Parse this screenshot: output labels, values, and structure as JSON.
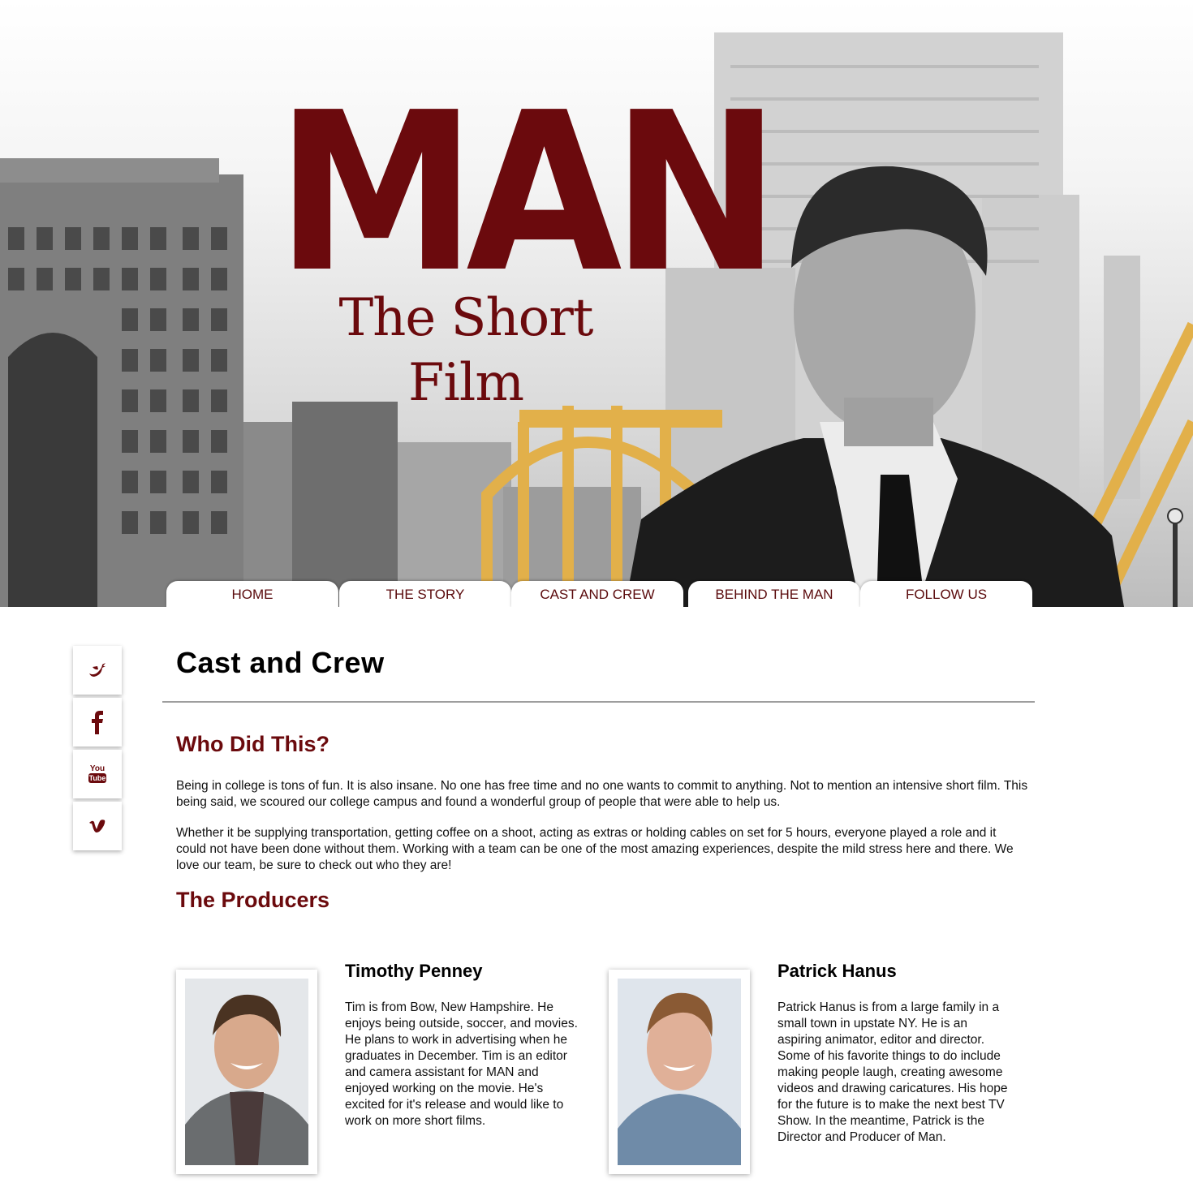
{
  "hero": {
    "logo_title": "MAN",
    "logo_subtitle": "The Short Film"
  },
  "nav": {
    "items": [
      {
        "label": "HOME"
      },
      {
        "label": "THE STORY"
      },
      {
        "label": "CAST AND CREW"
      },
      {
        "label": "BEHIND THE MAN"
      },
      {
        "label": "FOLLOW US"
      }
    ]
  },
  "social": [
    {
      "icon": "twitter-icon"
    },
    {
      "icon": "facebook-icon"
    },
    {
      "icon": "youtube-icon",
      "text_top": "You",
      "text_bottom": "Tube"
    },
    {
      "icon": "vimeo-icon"
    }
  ],
  "page": {
    "title": "Cast and Crew",
    "section1_heading": "Who Did This?",
    "para1": "Being in college is tons of fun. It is also insane. No one has free time and no one wants to commit to anything. Not to mention an intensive short film. This being said, we scoured our college campus and found a wonderful group of people that were able to help us.",
    "para2": "Whether it be supplying transportation, getting coffee on a shoot, acting as extras or holding cables on set for 5 hours, everyone played a role and it could not have been done without them. Working with a team can be one of the most amazing experiences, despite the mild stress here and there. We love our team, be sure to check out who they are!",
    "section2_heading": "The Producers"
  },
  "producers": [
    {
      "name": "Timothy Penney",
      "bio": "Tim is from Bow, New Hampshire. He enjoys being outside, soccer, and movies. He plans to work in advertising when he graduates in December. Tim is an editor and camera assistant for MAN and enjoyed working on the movie. He's excited for it's release and would like to work on more short films."
    },
    {
      "name": "Patrick Hanus",
      "bio": "Patrick Hanus is from a large family in a small town in upstate NY. He is an aspiring animator, editor and director. Some of his favorite things to do include making people laugh, creating awesome videos and drawing caricatures. His hope for the future is to make the next best TV Show. In the meantime, Patrick is the Director and Producer of Man."
    }
  ],
  "colors": {
    "brand": "#6b0a0d",
    "bridge": "#e2b04a",
    "divider": "#9e9e9e"
  }
}
